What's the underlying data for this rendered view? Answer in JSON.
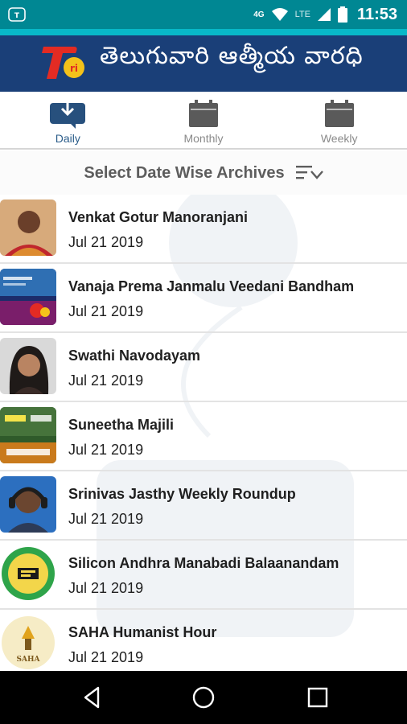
{
  "status_bar": {
    "network": "4G",
    "lte": "LTE",
    "time": "11:53"
  },
  "banner": {
    "title": "తెలుగువారి ఆత్మీయ వారధి",
    "logo_text": "Tori",
    "colors": {
      "background": "#1a3f78",
      "accent": "#08b8c8"
    }
  },
  "tabs": [
    {
      "label": "Daily",
      "icon": "download-calendar-icon",
      "active": true
    },
    {
      "label": "Monthly",
      "icon": "calendar-icon",
      "active": false
    },
    {
      "label": "Weekly",
      "icon": "calendar-icon",
      "active": false
    }
  ],
  "header": {
    "title": "Select Date Wise Archives",
    "icon": "sort-filter-icon"
  },
  "archives": [
    {
      "name": "Venkat Gotur Manoranjani",
      "date": "Jul 21 2019"
    },
    {
      "name": "Vanaja Prema Janmalu Veedani Bandham",
      "date": "Jul 21 2019"
    },
    {
      "name": "Swathi Navodayam",
      "date": "Jul 21 2019"
    },
    {
      "name": "Suneetha Majili",
      "date": "Jul 21 2019"
    },
    {
      "name": "Srinivas Jasthy Weekly Roundup",
      "date": "Jul 21 2019"
    },
    {
      "name": "Silicon Andhra Manabadi Balaanandam",
      "date": "Jul 21 2019"
    },
    {
      "name": "SAHA Humanist Hour",
      "date": "Jul 21 2019"
    }
  ],
  "thumb_captions": {
    "saha": "SAHA"
  },
  "navbar": {
    "back": "back-icon",
    "home": "home-icon",
    "recents": "recents-icon"
  }
}
